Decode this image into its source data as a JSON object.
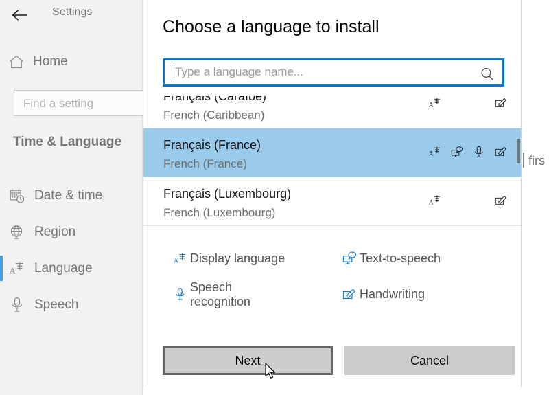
{
  "sidebar": {
    "back_icon": "back-arrow-icon",
    "title": "Settings",
    "home": {
      "label": "Home",
      "icon": "home-icon"
    },
    "find": {
      "placeholder": "Find a setting",
      "icon": "search-icon"
    },
    "section": "Time & Language",
    "items": [
      {
        "label": "Date & time",
        "icon": "calendar-clock-icon",
        "selected": false
      },
      {
        "label": "Region",
        "icon": "globe-icon",
        "selected": false
      },
      {
        "label": "Language",
        "icon": "display-language-icon",
        "selected": true
      },
      {
        "label": "Speech",
        "icon": "microphone-icon",
        "selected": false
      }
    ]
  },
  "dialog": {
    "title": "Choose a language to install",
    "search": {
      "placeholder": "Type a language name...",
      "value": "",
      "icon": "search-icon",
      "focused": true
    },
    "languages": [
      {
        "native": "Français (Caraïbe)",
        "english": "French (Caribbean)",
        "features": [
          "display-language",
          "handwriting"
        ]
      },
      {
        "native": "Français (France)",
        "english": "French (France)",
        "features": [
          "display-language",
          "text-to-speech",
          "speech-recognition",
          "handwriting"
        ],
        "selected": true
      },
      {
        "native": "Français (Luxembourg)",
        "english": "French (Luxembourg)",
        "features": [
          "display-language",
          "handwriting"
        ]
      }
    ],
    "legend": [
      {
        "label": "Display language",
        "icon": "display-language-icon"
      },
      {
        "label": "Text-to-speech",
        "icon": "text-to-speech-icon"
      },
      {
        "label": "Speech recognition",
        "icon": "microphone-icon"
      },
      {
        "label": "Handwriting",
        "icon": "handwriting-icon"
      }
    ],
    "buttons": {
      "next": "Next",
      "cancel": "Cancel"
    }
  },
  "background": {
    "clipped_text": "firs"
  },
  "colors": {
    "accent": "#0078d7",
    "selection": "#9bcbeb",
    "selection_bar": "#4ba0e8",
    "legend_icon": "#1a7ed0",
    "sidebar_bg": "#f2f2f2",
    "button_bg": "#cccccc"
  }
}
